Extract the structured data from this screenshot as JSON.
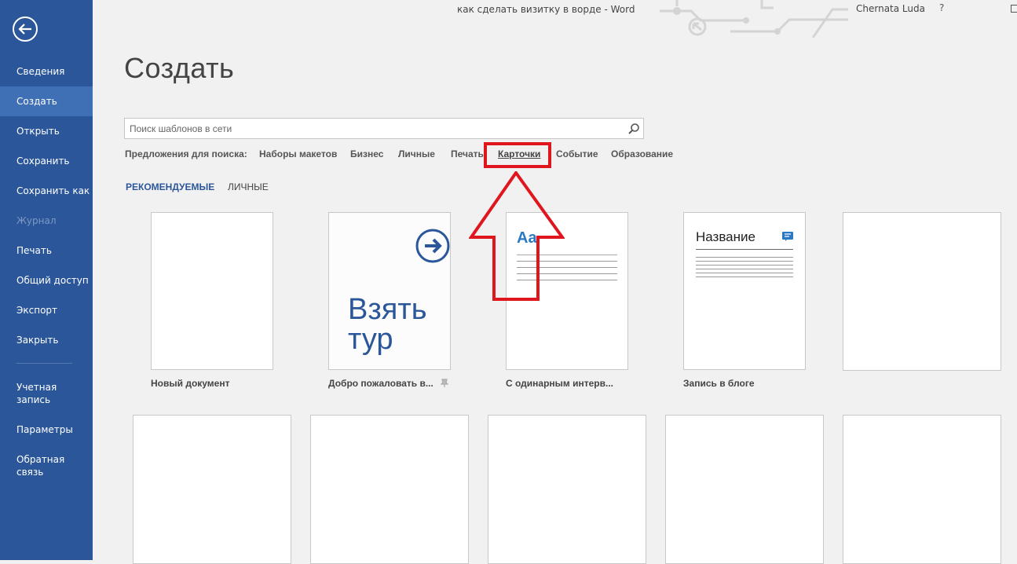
{
  "window": {
    "title": "как сделать визитку в ворде - Word",
    "user": "Chernata Luda",
    "help": "?"
  },
  "sidebar": {
    "items": [
      {
        "label": "Сведения",
        "state": "normal"
      },
      {
        "label": "Создать",
        "state": "active"
      },
      {
        "label": "Открыть",
        "state": "normal"
      },
      {
        "label": "Сохранить",
        "state": "normal"
      },
      {
        "label": "Сохранить как",
        "state": "normal"
      },
      {
        "label": "Журнал",
        "state": "disabled"
      },
      {
        "label": "Печать",
        "state": "normal"
      },
      {
        "label": "Общий доступ",
        "state": "normal"
      },
      {
        "label": "Экспорт",
        "state": "normal"
      },
      {
        "label": "Закрыть",
        "state": "normal"
      },
      {
        "label": "Учетная\nзапись",
        "state": "normal"
      },
      {
        "label": "Параметры",
        "state": "normal"
      },
      {
        "label": "Обратная\nсвязь",
        "state": "normal"
      }
    ]
  },
  "main": {
    "title": "Создать",
    "search": {
      "placeholder": "Поиск шаблонов в сети",
      "value": ""
    },
    "suggestions": {
      "label": "Предложения для поиска:",
      "items": [
        "Наборы макетов",
        "Бизнес",
        "Личные",
        "Печать",
        "Карточки",
        "Событие",
        "Образование"
      ],
      "highlighted": "Карточки"
    },
    "tabs": [
      {
        "label": "РЕКОМЕНДУЕМЫЕ",
        "active": true
      },
      {
        "label": "ЛИЧНЫЕ",
        "active": false
      }
    ],
    "templates": [
      {
        "caption": "Новый документ"
      },
      {
        "caption": "Добро пожаловать в...",
        "preview_text": "Взять\nтур",
        "pinned": true
      },
      {
        "caption": "С одинарным интерв...",
        "preview_text": "Aa"
      },
      {
        "caption": "Запись в блоге",
        "preview_text": "Название"
      }
    ]
  },
  "colors": {
    "sidebar": "#2b579a",
    "sidebar_active": "#3f6fb4",
    "accent": "#2b579a",
    "annotation": "#e0161e"
  }
}
